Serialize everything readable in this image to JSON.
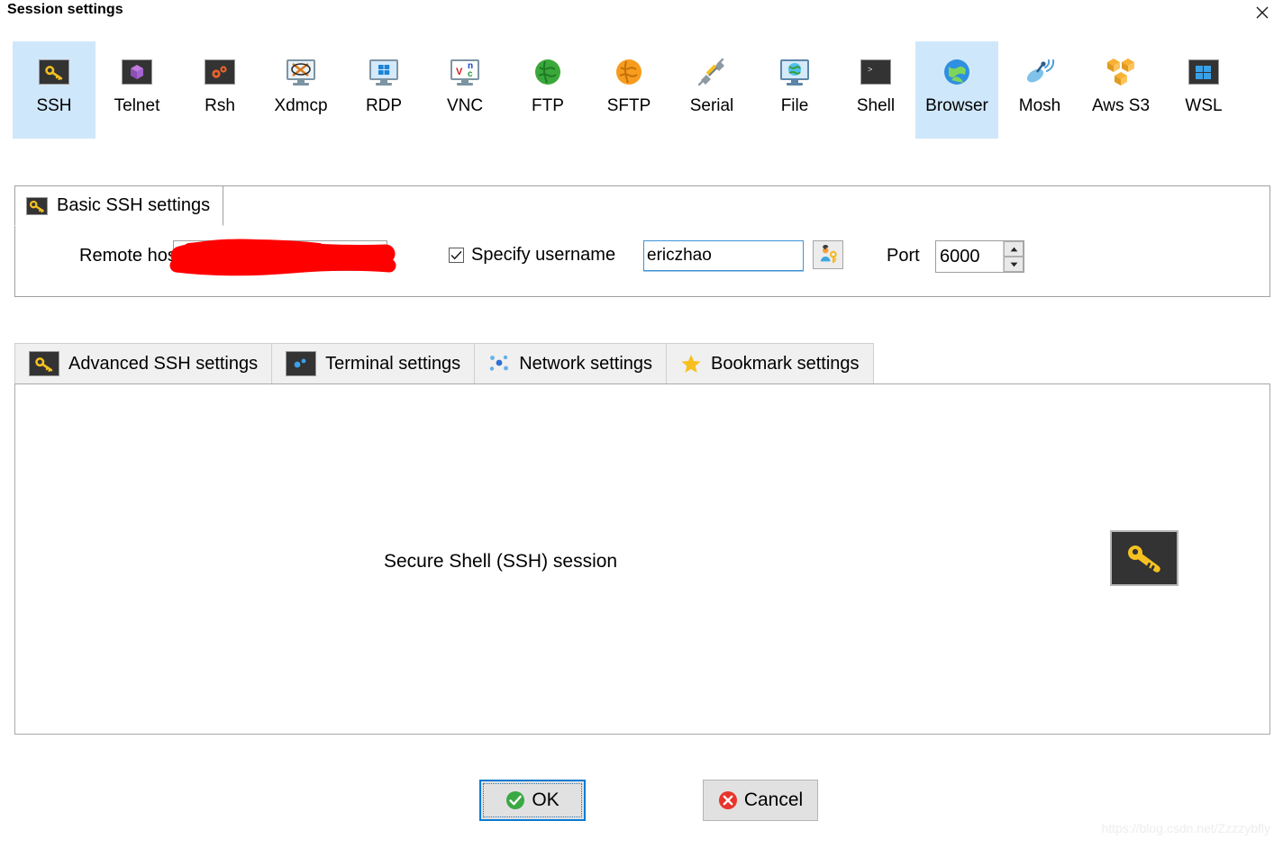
{
  "window": {
    "title": "Session settings",
    "close_label": "×"
  },
  "session_types": [
    {
      "label": "SSH",
      "icon": "ssh-key-icon",
      "selected": true
    },
    {
      "label": "Telnet",
      "icon": "telnet-cube-icon",
      "selected": false
    },
    {
      "label": "Rsh",
      "icon": "rsh-gears-icon",
      "selected": false
    },
    {
      "label": "Xdmcp",
      "icon": "xdmcp-monitor-icon",
      "selected": false
    },
    {
      "label": "RDP",
      "icon": "rdp-windows-icon",
      "selected": false
    },
    {
      "label": "VNC",
      "icon": "vnc-monitor-icon",
      "selected": false
    },
    {
      "label": "FTP",
      "icon": "ftp-globe-icon",
      "selected": false
    },
    {
      "label": "SFTP",
      "icon": "sftp-globe-icon",
      "selected": false
    },
    {
      "label": "Serial",
      "icon": "serial-plug-icon",
      "selected": false
    },
    {
      "label": "File",
      "icon": "file-monitor-icon",
      "selected": false
    },
    {
      "label": "Shell",
      "icon": "shell-prompt-icon",
      "selected": false
    },
    {
      "label": "Browser",
      "icon": "browser-globe-icon",
      "selected": true
    },
    {
      "label": "Mosh",
      "icon": "mosh-satellite-icon",
      "selected": false
    },
    {
      "label": "Aws S3",
      "icon": "aws-s3-cubes-icon",
      "selected": false
    },
    {
      "label": "WSL",
      "icon": "wsl-windows-icon",
      "selected": false
    }
  ],
  "basic_group": {
    "tab_label": "Basic SSH settings",
    "tab_icon": "key-icon",
    "remote_host": {
      "label": "Remote host *",
      "value": "",
      "redacted": true
    },
    "username": {
      "checkbox_label": "Specify username",
      "checked": true,
      "value": "ericzhao",
      "picker_icon": "user-key-icon"
    },
    "port": {
      "label": "Port",
      "value": "6000",
      "up_icon": "chevron-up-icon",
      "down_icon": "chevron-down-icon"
    }
  },
  "settings_tabs": [
    {
      "label": "Advanced SSH settings",
      "icon": "key-icon",
      "active": false
    },
    {
      "label": "Terminal settings",
      "icon": "terminal-icon",
      "active": false
    },
    {
      "label": "Network settings",
      "icon": "network-icon",
      "active": false
    },
    {
      "label": "Bookmark settings",
      "icon": "star-icon",
      "active": false
    }
  ],
  "content": {
    "description": "Secure Shell (SSH) session",
    "badge_icon": "key-icon"
  },
  "buttons": {
    "ok": {
      "label": "OK",
      "icon": "check-circle-icon"
    },
    "cancel": {
      "label": "Cancel",
      "icon": "x-circle-icon"
    }
  },
  "watermark": "https://blog.csdn.net/Zzzzybfly",
  "colors": {
    "selection": "#cfe7fa",
    "accent": "#0a7bd0",
    "ok_green": "#3aa843",
    "cancel_red": "#e8352b",
    "key_gold": "#f5c120",
    "redaction_red": "#fe0000",
    "panel_border": "#a9a9a9"
  }
}
